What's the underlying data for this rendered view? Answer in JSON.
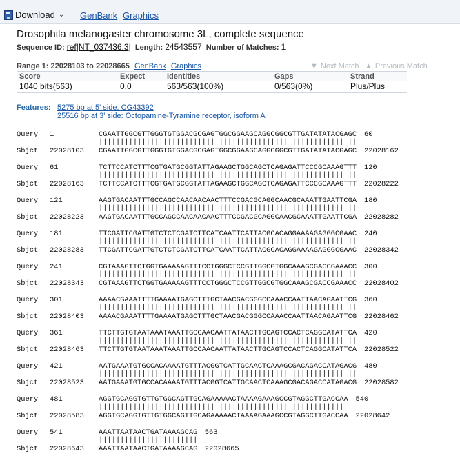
{
  "toolbar": {
    "download": "Download",
    "genbank": "GenBank",
    "graphics": "Graphics"
  },
  "header": {
    "title": "Drosophila melanogaster chromosome 3L, complete sequence",
    "seqid_label": "Sequence ID:",
    "seqid_value": "ref|NT_037436.3|",
    "length_label": "Length:",
    "length_value": "24543557",
    "matches_label": "Number of Matches:",
    "matches_value": "1"
  },
  "range": {
    "label": "Range 1: 22028103 to 22028665",
    "genbank": "GenBank",
    "graphics": "Graphics",
    "next": "Next Match",
    "prev": "Previous Match"
  },
  "summary": {
    "headers": [
      "Score",
      "Expect",
      "Identities",
      "Gaps",
      "Strand"
    ],
    "values": [
      "1040 bits(563)",
      "0.0",
      "563/563(100%)",
      "0/563(0%)",
      "Plus/Plus"
    ]
  },
  "features": {
    "label": "Features:",
    "items": [
      "5275 bp at 5' side: CG43392",
      "25516 bp at 3' side: Octopamine-Tyramine receptor, isoform A"
    ]
  },
  "alignment": [
    {
      "q_start": "1",
      "q_seq": "CGAATTGGCGTTGGGTGTGGACGCGAGTGGCGGAAGCAGGCGGCGTTGATATATACGAGC",
      "q_end": "60",
      "s_start": "22028103",
      "s_seq": "CGAATTGGCGTTGGGTGTGGACGCGAGTGGCGGAAGCAGGCGGCGTTGATATATACGAGC",
      "s_end": "22028162"
    },
    {
      "q_start": "61",
      "q_seq": "TCTTCCATCTTTCGTGATGCGGTATTAGAAGCTGGCAGCTCAGAGATTCCCGCAAAGTTT",
      "q_end": "120",
      "s_start": "22028163",
      "s_seq": "TCTTCCATCTTTCGTGATGCGGTATTAGAAGCTGGCAGCTCAGAGATTCCCGCAAAGTTT",
      "s_end": "22028222"
    },
    {
      "q_start": "121",
      "q_seq": "AAGTGACAATTTGCCAGCCAACAACAACTTTCCGACGCAGGCAACGCAAATTGAATTCGA",
      "q_end": "180",
      "s_start": "22028223",
      "s_seq": "AAGTGACAATTTGCCAGCCAACAACAACTTTCCGACGCAGGCAACGCAAATTGAATTCGA",
      "s_end": "22028282"
    },
    {
      "q_start": "181",
      "q_seq": "TTCGATTCGATTGTCTCTCGATCTTCATCAATTCATTACGCACAGGAAAAGAGGGCGAAC",
      "q_end": "240",
      "s_start": "22028283",
      "s_seq": "TTCGATTCGATTGTCTCTCGATCTTCATCAATTCATTACGCACAGGAAAAGAGGGCGAAC",
      "s_end": "22028342"
    },
    {
      "q_start": "241",
      "q_seq": "CGTAAAGTTCTGGTGAAAAAGTTTCCTGGGCTCCGTTGGCGTGGCAAAGCGACCGAAACC",
      "q_end": "300",
      "s_start": "22028343",
      "s_seq": "CGTAAAGTTCTGGTGAAAAAGTTTCCTGGGCTCCGTTGGCGTGGCAAAGCGACCGAAACC",
      "s_end": "22028402"
    },
    {
      "q_start": "301",
      "q_seq": "AAAACGAAATTTTGAAAATGAGCTTTGCTAACGACGGGCCAAACCAATTAACAGAATTCG",
      "q_end": "360",
      "s_start": "22028403",
      "s_seq": "AAAACGAAATTTTGAAAATGAGCTTTGCTAACGACGGGCCAAACCAATTAACAGAATTCG",
      "s_end": "22028462"
    },
    {
      "q_start": "361",
      "q_seq": "TTCTTGTGTAATAAATAAATTGCCAACAATTATAACTTGCAGTCCACTCAGGCATATTCA",
      "q_end": "420",
      "s_start": "22028463",
      "s_seq": "TTCTTGTGTAATAAATAAATTGCCAACAATTATAACTTGCAGTCCACTCAGGCATATTCA",
      "s_end": "22028522"
    },
    {
      "q_start": "421",
      "q_seq": "AATGAAATGTGCCACAAAATGTTTACGGTCATTGCAACTCAAAGCGACAGACCATAGACG",
      "q_end": "480",
      "s_start": "22028523",
      "s_seq": "AATGAAATGTGCCACAAAATGTTTACGGTCATTGCAACTCAAAGCGACAGACCATAGACG",
      "s_end": "22028582"
    },
    {
      "q_start": "481",
      "q_seq": "AGGTGCAGGTGTTGTGGCAGTTGCAGAAAAACTAAAAGAAAGCCGTAGGCTTGACCAA",
      "q_end": "540",
      "s_start": "22028583",
      "s_seq": "AGGTGCAGGTGTTGTGGCAGTTGCAGAAAAACTAAAAGAAAGCCGTAGGCTTGACCAA",
      "s_end": "22028642"
    },
    {
      "q_start": "541",
      "q_seq": "AAATTAATAACTGATAAAAGCAG",
      "q_end": "563",
      "s_start": "22028643",
      "s_seq": "AAATTAATAACTGATAAAAGCAG",
      "s_end": "22028665"
    }
  ]
}
